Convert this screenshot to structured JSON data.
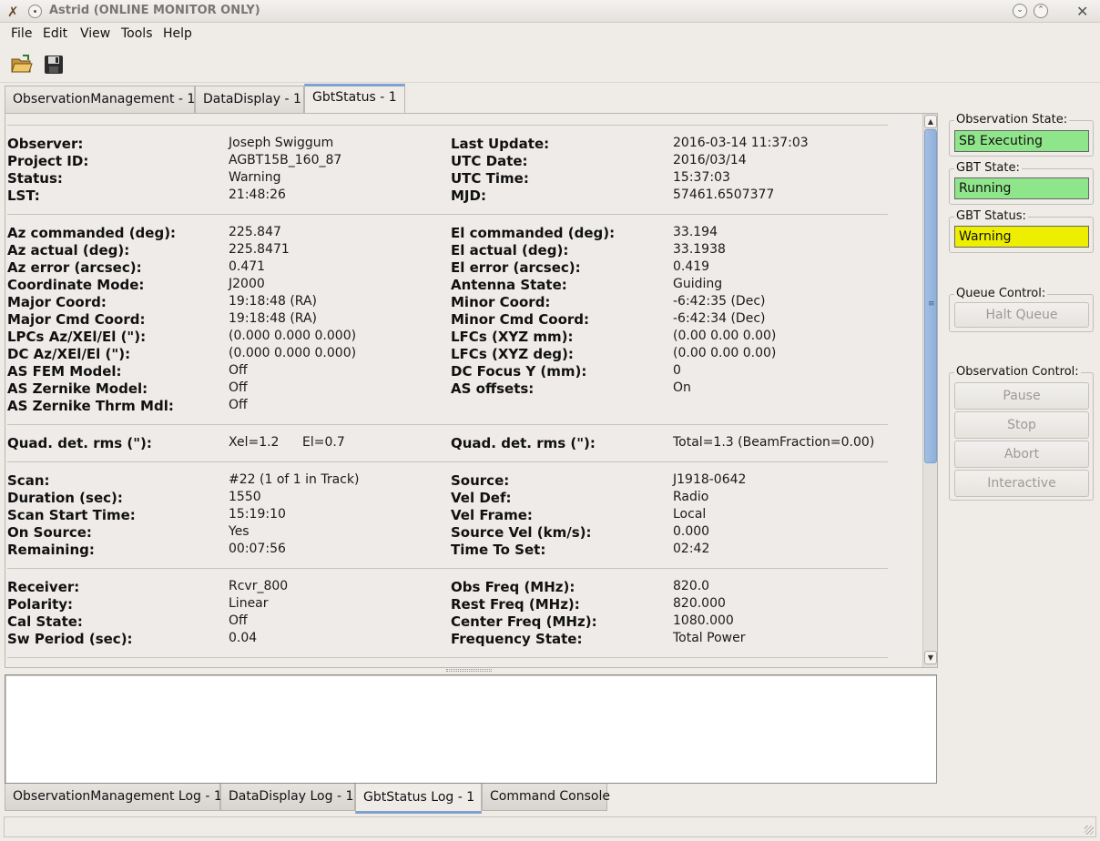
{
  "window": {
    "title": "Astrid (ONLINE MONITOR ONLY)"
  },
  "menu": [
    "File",
    "Edit",
    "View",
    "Tools",
    "Help"
  ],
  "toolbar": {
    "buttons": [
      "open-folder-icon",
      "save-disk-icon"
    ]
  },
  "tabs": [
    {
      "label": "ObservationManagement - 1",
      "active": false
    },
    {
      "label": "DataDisplay - 1",
      "active": false
    },
    {
      "label": "GbtStatus - 1",
      "active": true
    }
  ],
  "status": {
    "observer": {
      "label": "Observer:",
      "value": "Joseph Swiggum"
    },
    "project_id": {
      "label": "Project ID:",
      "value": "AGBT15B_160_87"
    },
    "status": {
      "label": "Status:",
      "value": "Warning"
    },
    "lst": {
      "label": "LST:",
      "value": "21:48:26"
    },
    "last_update": {
      "label": "Last Update:",
      "value": "2016-03-14 11:37:03"
    },
    "utc_date": {
      "label": "UTC Date:",
      "value": "2016/03/14"
    },
    "utc_time": {
      "label": "UTC Time:",
      "value": "15:37:03"
    },
    "mjd": {
      "label": "MJD:",
      "value": "57461.6507377"
    },
    "az_cmd": {
      "label": "Az commanded (deg):",
      "value": "225.847"
    },
    "az_act": {
      "label": "Az actual (deg):",
      "value": "225.8471"
    },
    "az_err": {
      "label": "Az error (arcsec):",
      "value": "0.471"
    },
    "coord_mode": {
      "label": "Coordinate Mode:",
      "value": "J2000"
    },
    "major_coord": {
      "label": "Major Coord:",
      "value": "19:18:48 (RA)"
    },
    "major_cmd": {
      "label": "Major Cmd Coord:",
      "value": "19:18:48 (RA)"
    },
    "lpcs": {
      "label": "LPCs Az/XEl/El (\"):",
      "value": "(0.000 0.000 0.000)"
    },
    "dc_az": {
      "label": "DC Az/XEl/El (\"):",
      "value": "(0.000 0.000 0.000)"
    },
    "as_fem": {
      "label": "AS FEM Model:",
      "value": "Off"
    },
    "as_zern": {
      "label": "AS Zernike Model:",
      "value": "Off"
    },
    "as_zern_thrm": {
      "label": "AS Zernike Thrm Mdl:",
      "value": "Off"
    },
    "el_cmd": {
      "label": "El commanded (deg):",
      "value": "33.194"
    },
    "el_act": {
      "label": "El actual (deg):",
      "value": "33.1938"
    },
    "el_err": {
      "label": "El error (arcsec):",
      "value": "0.419"
    },
    "antenna_state": {
      "label": "Antenna State:",
      "value": "Guiding"
    },
    "minor_coord": {
      "label": "Minor Coord:",
      "value": "-6:42:35 (Dec)"
    },
    "minor_cmd": {
      "label": "Minor Cmd Coord:",
      "value": "-6:42:34 (Dec)"
    },
    "lfcs_mm": {
      "label": "LFCs (XYZ mm):",
      "value": "(0.00 0.00 0.00)"
    },
    "lfcs_deg": {
      "label": "LFCs (XYZ deg):",
      "value": "(0.00 0.00 0.00)"
    },
    "dc_focus": {
      "label": "DC Focus Y (mm):",
      "value": "0"
    },
    "as_offsets": {
      "label": "AS offsets:",
      "value": "On"
    },
    "quad1": {
      "label": "Quad. det. rms (\"):",
      "xel": "Xel=1.2",
      "el": "El=0.7"
    },
    "quad2": {
      "label": "Quad. det. rms (\"):",
      "value": "Total=1.3 (BeamFraction=0.00)"
    },
    "scan": {
      "label": "Scan:",
      "value": "#22 (1 of 1 in Track)"
    },
    "duration": {
      "label": "Duration (sec):",
      "value": "1550"
    },
    "scan_start": {
      "label": "Scan Start Time:",
      "value": "15:19:10"
    },
    "on_source": {
      "label": "On Source:",
      "value": "Yes"
    },
    "remaining": {
      "label": "Remaining:",
      "value": "00:07:56"
    },
    "source": {
      "label": "Source:",
      "value": "J1918-0642"
    },
    "vel_def": {
      "label": "Vel Def:",
      "value": "Radio"
    },
    "vel_frame": {
      "label": "Vel Frame:",
      "value": "Local"
    },
    "source_vel": {
      "label": "Source Vel (km/s):",
      "value": "0.000"
    },
    "time_to_set": {
      "label": "Time To Set:",
      "value": "02:42"
    },
    "receiver": {
      "label": "Receiver:",
      "value": "Rcvr_800"
    },
    "polarity": {
      "label": "Polarity:",
      "value": "Linear"
    },
    "cal_state": {
      "label": "Cal State:",
      "value": "Off"
    },
    "sw_period": {
      "label": "Sw Period (sec):",
      "value": "0.04"
    },
    "obs_freq": {
      "label": "Obs Freq (MHz):",
      "value": "820.0"
    },
    "rest_freq": {
      "label": "Rest Freq (MHz):",
      "value": "820.000"
    },
    "center_freq": {
      "label": "Center Freq (MHz):",
      "value": "1080.000"
    },
    "freq_state": {
      "label": "Frequency State:",
      "value": "Total Power"
    }
  },
  "log_tabs": [
    {
      "label": "ObservationManagement Log - 1",
      "active": false
    },
    {
      "label": "DataDisplay Log - 1",
      "active": false
    },
    {
      "label": "GbtStatus Log - 1",
      "active": true
    },
    {
      "label": "Command Console",
      "active": false
    }
  ],
  "side": {
    "obs_state": {
      "title": "Observation State:",
      "value": "SB Executing",
      "color": "#8fe68a"
    },
    "gbt_state": {
      "title": "GBT State:",
      "value": "Running",
      "color": "#8fe68a"
    },
    "gbt_status": {
      "title": "GBT Status:",
      "value": "Warning",
      "color": "#eeee00"
    },
    "queue_control": {
      "title": "Queue Control:",
      "halt": "Halt Queue"
    },
    "obs_control": {
      "title": "Observation Control:",
      "pause": "Pause",
      "stop": "Stop",
      "abort": "Abort",
      "interactive": "Interactive"
    }
  }
}
